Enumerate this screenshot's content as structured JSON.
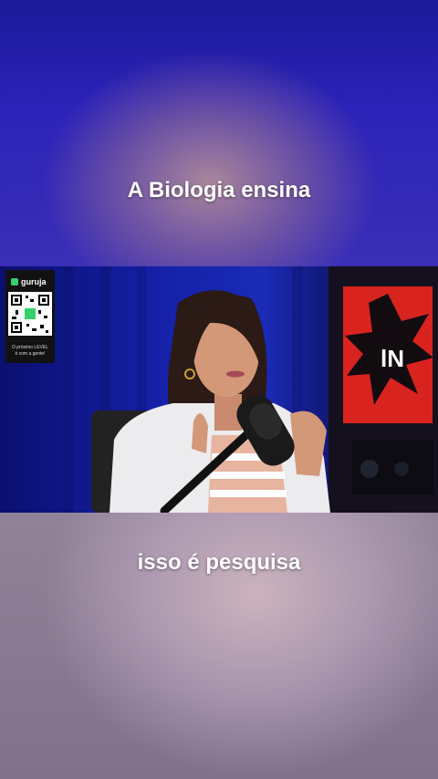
{
  "captions": {
    "top": "A Biologia ensina",
    "bottom": "isso é pesquisa"
  },
  "overlay": {
    "brand": "guruja",
    "tagline_line1": "O próximo LEVEL",
    "tagline_line2": "é com a gente!"
  },
  "colors": {
    "studio_blue": "#1a2bb8",
    "caption_text": "#ffffff",
    "brand_green": "#35d06b",
    "red_panel": "#d8231f"
  },
  "icons": {
    "qr": "qr-code-icon",
    "mic": "microphone-icon"
  }
}
